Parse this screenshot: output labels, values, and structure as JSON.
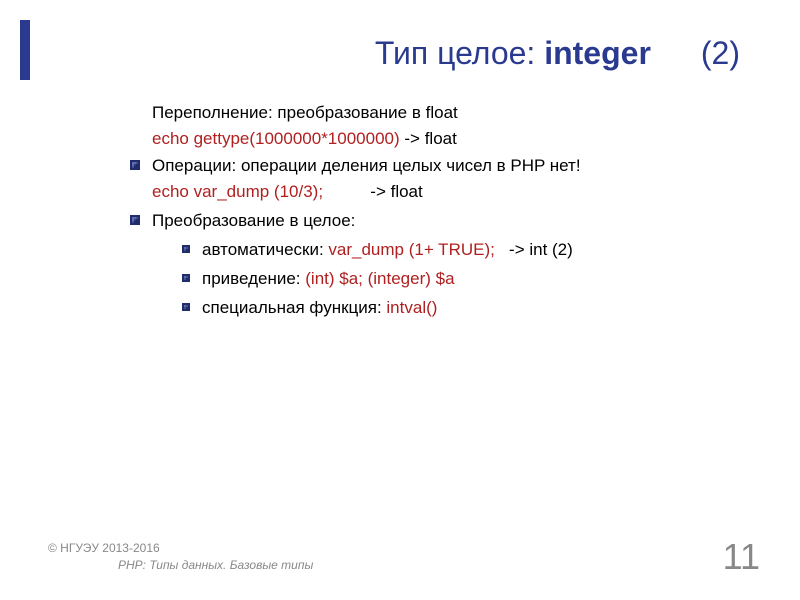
{
  "title": {
    "prefix": "Тип целое: ",
    "keyword": "integer",
    "number": "(2)"
  },
  "content": {
    "line0a": "Переполнение: преобразование в float",
    "line0b_red": "echo gettype(1000000*1000000)",
    "line0b_tail": "  -> float",
    "line1a": "Операции: операции деления целых чисел в PHP нет!",
    "line1b_red": "echo var_dump (10/3);",
    "line1b_tail": "          -> float",
    "line2": "Преобразование в целое:",
    "nested": [
      {
        "label": " автоматически: ",
        "red": "var_dump (1+ TRUE);",
        "tail": "   -> int (2)"
      },
      {
        "label": "приведение: ",
        "red": "(int) $a; (integer) $a",
        "tail": ""
      },
      {
        "label": "специальная функция: ",
        "red": "intval()",
        "tail": ""
      }
    ]
  },
  "footer": {
    "copyright": "© НГУЭУ 2013-2016",
    "subtitle": "PHP: Типы данных. Базовые типы"
  },
  "page": "11"
}
